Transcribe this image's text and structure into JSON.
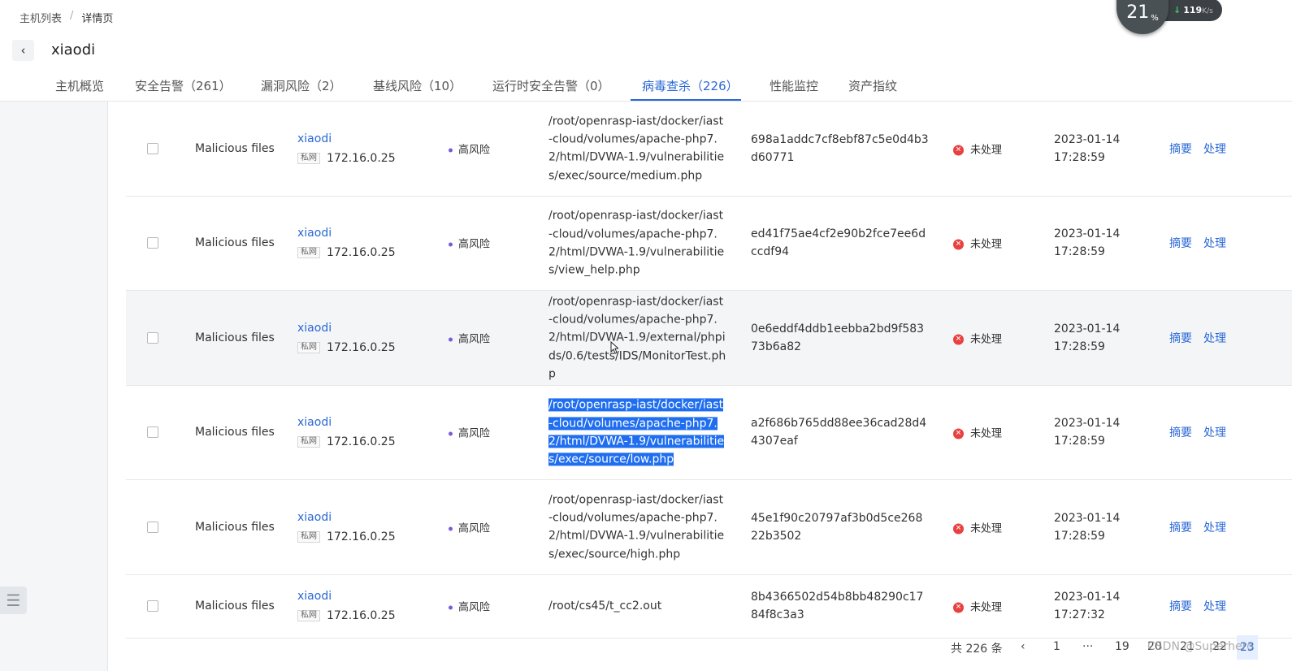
{
  "breadcrumb": {
    "parent": "主机列表",
    "separator": "/",
    "current": "详情页"
  },
  "header": {
    "back_icon": "‹",
    "title": "xiaodi"
  },
  "tabs": [
    {
      "label": "主机概览"
    },
    {
      "label": "安全告警（261）"
    },
    {
      "label": "漏洞风险（2）"
    },
    {
      "label": "基线风险（10）"
    },
    {
      "label": "运行时安全告警（0）"
    },
    {
      "label": "病毒查杀（226）",
      "active": true
    },
    {
      "label": "性能监控"
    },
    {
      "label": "资产指纹"
    }
  ],
  "speed_widget": {
    "percent": "21",
    "percent_unit": "%",
    "down_value": "119",
    "down_unit": "K/s"
  },
  "rows": [
    {
      "type": "Malicious files",
      "host": "xiaodi",
      "net_tag": "私网",
      "ip": "172.16.0.25",
      "risk": "高风险",
      "path": "/root/openrasp-iast/docker/iast-cloud/volumes/apache-php7.2/html/DVWA-1.9/vulnerabilities/exec/source/medium.php",
      "hash": "698a1addc7cf8ebf87c5e0d4b3d60771",
      "status": "未处理",
      "date": "2023-01-14",
      "time": "17:28:59",
      "action1": "摘要",
      "action2": "处理"
    },
    {
      "type": "Malicious files",
      "host": "xiaodi",
      "net_tag": "私网",
      "ip": "172.16.0.25",
      "risk": "高风险",
      "path": "/root/openrasp-iast/docker/iast-cloud/volumes/apache-php7.2/html/DVWA-1.9/vulnerabilities/view_help.php",
      "hash": "ed41f75ae4cf2e90b2fce7ee6dccdf94",
      "status": "未处理",
      "date": "2023-01-14",
      "time": "17:28:59",
      "action1": "摘要",
      "action2": "处理"
    },
    {
      "type": "Malicious files",
      "host": "xiaodi",
      "net_tag": "私网",
      "ip": "172.16.0.25",
      "risk": "高风险",
      "path": "/root/openrasp-iast/docker/iast-cloud/volumes/apache-php7.2/html/DVWA-1.9/external/phpids/0.6/tests/IDS/MonitorTest.php",
      "hash": "0e6eddf4ddb1eebba2bd9f58373b6a82",
      "status": "未处理",
      "date": "2023-01-14",
      "time": "17:28:59",
      "action1": "摘要",
      "action2": "处理"
    },
    {
      "type": "Malicious files",
      "host": "xiaodi",
      "net_tag": "私网",
      "ip": "172.16.0.25",
      "risk": "高风险",
      "path": "/root/openrasp-iast/docker/iast-cloud/volumes/apache-php7.2/html/DVWA-1.9/vulnerabilities/exec/source/low.php",
      "hash": "a2f686b765dd88ee36cad28d44307eaf",
      "status": "未处理",
      "date": "2023-01-14",
      "time": "17:28:59",
      "action1": "摘要",
      "action2": "处理"
    },
    {
      "type": "Malicious files",
      "host": "xiaodi",
      "net_tag": "私网",
      "ip": "172.16.0.25",
      "risk": "高风险",
      "path": "/root/openrasp-iast/docker/iast-cloud/volumes/apache-php7.2/html/DVWA-1.9/vulnerabilities/exec/source/high.php",
      "hash": "45e1f90c20797af3b0d5ce26822b3502",
      "status": "未处理",
      "date": "2023-01-14",
      "time": "17:28:59",
      "action1": "摘要",
      "action2": "处理"
    },
    {
      "type": "Malicious files",
      "host": "xiaodi",
      "net_tag": "私网",
      "ip": "172.16.0.25",
      "risk": "高风险",
      "path": "/root/cs45/t_cc2.out",
      "hash": "8b4366502d54b8bb48290c1784f8c3a3",
      "status": "未处理",
      "date": "2023-01-14",
      "time": "17:27:32",
      "action1": "摘要",
      "action2": "处理"
    }
  ],
  "pagination": {
    "total": "共 226 条",
    "prev": "‹",
    "first": "1",
    "ellipsis": "···",
    "pages": [
      "19",
      "20",
      "21",
      "22",
      "23"
    ]
  },
  "watermark": "CSDN @Superhero",
  "colors": {
    "accent": "#2a68d6",
    "danger": "#e94040",
    "risk_dot": "#7a5ad6",
    "selection": "#1f6ef0"
  }
}
